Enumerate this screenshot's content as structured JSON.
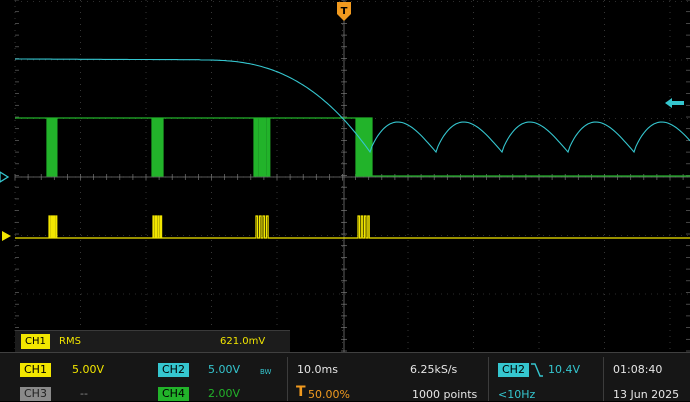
{
  "colors": {
    "ch1": "#f2e600",
    "ch2": "#35c6cf",
    "ch3": "#8a8a8a",
    "ch4": "#22b32a",
    "grid": "#5a5a5a",
    "trigger": "#f19a1f",
    "text": "#e6e6e6",
    "bg": "#000000"
  },
  "trigger_marker": {
    "label": "T"
  },
  "measurement": {
    "channel": "CH1",
    "type": "RMS",
    "value": "621.0mV"
  },
  "channels": [
    {
      "name": "CH1",
      "scale": "5.00V"
    },
    {
      "name": "CH2",
      "scale": "5.00V",
      "bw_icon": "bandwidth-limit-icon",
      "bw_label": "BW"
    },
    {
      "name": "CH3",
      "scale": "--"
    },
    {
      "name": "CH4",
      "scale": "2.00V"
    }
  ],
  "timebase": {
    "scale": "10.0ms",
    "sample_rate": "6.25kS/s",
    "trigger_position": "50.00%",
    "record_length": "1000 points"
  },
  "trigger": {
    "source": "CH2",
    "slope_icon": "falling-edge-icon",
    "level": "10.4V",
    "frequency": "<10Hz"
  },
  "clock": {
    "time": "01:08:40",
    "date": "13 Jun 2025"
  },
  "icons": [
    "trigger-position-icon",
    "ch1-ground-marker-icon",
    "ch2-ground-marker-icon",
    "ch2-offscreen-arrow-icon",
    "falling-edge-icon",
    "bandwidth-limit-icon"
  ]
}
